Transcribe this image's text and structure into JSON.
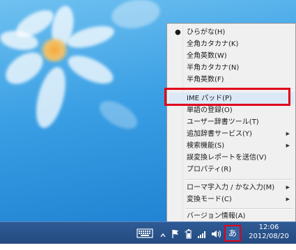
{
  "menu": {
    "items": [
      {
        "label": "ひらがな(H)",
        "checked": true
      },
      {
        "label": "全角カタカナ(K)"
      },
      {
        "label": "全角英数(W)"
      },
      {
        "label": "半角カタカナ(N)"
      },
      {
        "label": "半角英数(F)"
      },
      {
        "label": "IME パッド(P)"
      },
      {
        "label": "単語の登録(O)"
      },
      {
        "label": "ユーザー辞書ツール(T)"
      },
      {
        "label": "追加辞書サービス(Y)",
        "submenu": true
      },
      {
        "label": "検索機能(S)",
        "submenu": true
      },
      {
        "label": "誤変換レポートを送信(V)"
      },
      {
        "label": "プロパティ(R)"
      },
      {
        "label": "ローマ字入力 / かな入力(M)",
        "submenu": true
      },
      {
        "label": "変換モード(C)",
        "submenu": true
      },
      {
        "label": "バージョン情報(A)"
      }
    ],
    "bullet_glyph": "●",
    "arrow_glyph": "▶"
  },
  "taskbar": {
    "ime_mode": "あ",
    "time": "12:06",
    "date": "2012/08/20",
    "tray_icons": [
      "keyboard-icon",
      "show-hidden-icons-chevron",
      "flag-icon",
      "battery-icon",
      "network-signal-icon",
      "volume-icon"
    ]
  }
}
